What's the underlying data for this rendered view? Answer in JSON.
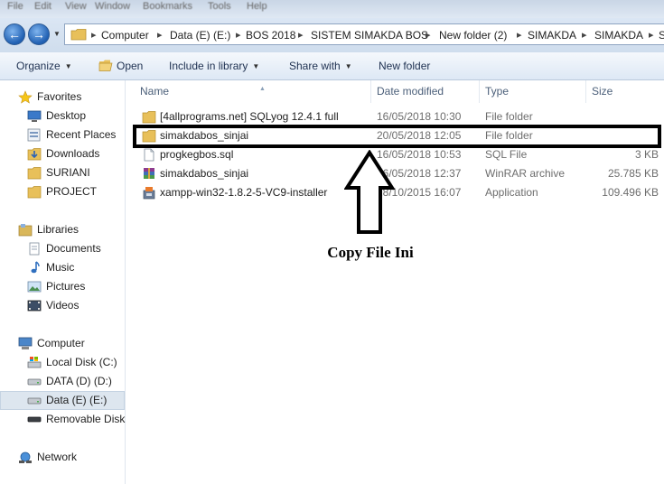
{
  "menubar": {
    "items": [
      "File",
      "Edit",
      "View",
      "Window",
      "Bookmarks",
      "Tools",
      "Help"
    ]
  },
  "address": {
    "breadcrumbs": [
      "Computer",
      "Data (E) (E:)",
      "BOS 2018",
      "SISTEM SIMAKDA BOS",
      "New folder (2)",
      "SIMAKDA",
      "SIMAKDA",
      "S"
    ]
  },
  "toolbar": {
    "organize": "Organize",
    "open": "Open",
    "include_in_library": "Include in library",
    "share_with": "Share with",
    "new_folder": "New folder"
  },
  "nav": {
    "favorites": {
      "label": "Favorites",
      "items": [
        "Desktop",
        "Recent Places",
        "Downloads",
        "SURIANI",
        "PROJECT"
      ]
    },
    "libraries": {
      "label": "Libraries",
      "items": [
        "Documents",
        "Music",
        "Pictures",
        "Videos"
      ]
    },
    "computer": {
      "label": "Computer",
      "items": [
        "Local Disk (C:)",
        "DATA (D) (D:)",
        "Data (E) (E:)",
        "Removable Disk"
      ]
    },
    "network": {
      "label": "Network"
    }
  },
  "columns": {
    "name": "Name",
    "date": "Date modified",
    "type": "Type",
    "size": "Size"
  },
  "files": [
    {
      "name": "[4allprograms.net] SQLyog 12.4.1 full",
      "date": "16/05/2018 10:30",
      "type": "File folder",
      "size": "",
      "icon": "folder-icon"
    },
    {
      "name": "simakdabos_sinjai",
      "date": "20/05/2018 12:05",
      "type": "File folder",
      "size": "",
      "icon": "folder-icon"
    },
    {
      "name": "progkegbos.sql",
      "date": "16/05/2018 10:53",
      "type": "SQL File",
      "size": "3 KB",
      "icon": "document-icon"
    },
    {
      "name": "simakdabos_sinjai",
      "date": "16/05/2018 12:37",
      "type": "WinRAR archive",
      "size": "25.785 KB",
      "icon": "archive-icon"
    },
    {
      "name": "xampp-win32-1.8.2-5-VC9-installer",
      "date": "28/10/2015 16:07",
      "type": "Application",
      "size": "109.496 KB",
      "icon": "installer-icon"
    }
  ],
  "annotation": {
    "text": "Copy File Ini"
  },
  "colors": {
    "accent": "#1f5fb2",
    "folder": "#e8c05a",
    "highlight": "#000000"
  }
}
